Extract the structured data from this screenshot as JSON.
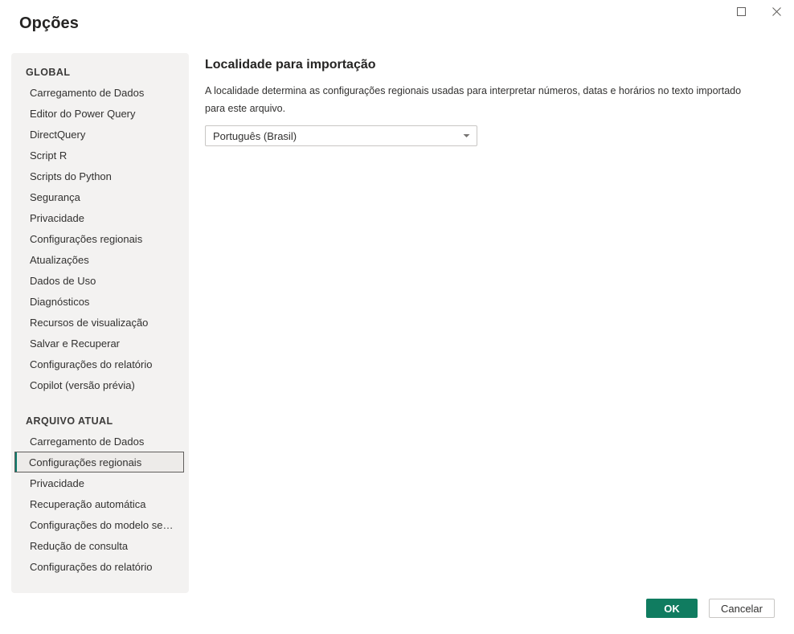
{
  "window": {
    "title": "Opções",
    "controls": [
      {
        "name": "maximize-button",
        "icon": "maximize-icon"
      },
      {
        "name": "close-button",
        "icon": "close-icon"
      }
    ]
  },
  "sidebar": {
    "groups": [
      {
        "header": "GLOBAL",
        "items": [
          {
            "label": "Carregamento de Dados",
            "selected": false
          },
          {
            "label": "Editor do Power Query",
            "selected": false
          },
          {
            "label": "DirectQuery",
            "selected": false
          },
          {
            "label": "Script R",
            "selected": false
          },
          {
            "label": "Scripts do Python",
            "selected": false
          },
          {
            "label": "Segurança",
            "selected": false
          },
          {
            "label": "Privacidade",
            "selected": false
          },
          {
            "label": "Configurações regionais",
            "selected": false
          },
          {
            "label": "Atualizações",
            "selected": false
          },
          {
            "label": "Dados de Uso",
            "selected": false
          },
          {
            "label": "Diagnósticos",
            "selected": false
          },
          {
            "label": "Recursos de visualização",
            "selected": false
          },
          {
            "label": "Salvar e Recuperar",
            "selected": false
          },
          {
            "label": "Configurações do relatório",
            "selected": false
          },
          {
            "label": "Copilot (versão prévia)",
            "selected": false
          }
        ]
      },
      {
        "header": "ARQUIVO ATUAL",
        "items": [
          {
            "label": "Carregamento de Dados",
            "selected": false
          },
          {
            "label": "Configurações regionais",
            "selected": true
          },
          {
            "label": "Privacidade",
            "selected": false
          },
          {
            "label": "Recuperação automática",
            "selected": false
          },
          {
            "label": "Configurações do modelo semân...",
            "selected": false
          },
          {
            "label": "Redução de consulta",
            "selected": false
          },
          {
            "label": "Configurações do relatório",
            "selected": false
          }
        ]
      }
    ]
  },
  "main": {
    "heading": "Localidade para importação",
    "description": "A localidade determina as configurações regionais usadas para interpretar números, datas e horários no texto importado para este arquivo.",
    "locale_dropdown": {
      "value": "Português (Brasil)",
      "caret_icon": "chevron-down-icon"
    }
  },
  "footer": {
    "ok_label": "OK",
    "cancel_label": "Cancelar"
  },
  "colors": {
    "accent": "#107c60",
    "selected_accent": "#0f7b6c",
    "sidebar_bg": "#f3f2f1",
    "text": "#323130"
  }
}
